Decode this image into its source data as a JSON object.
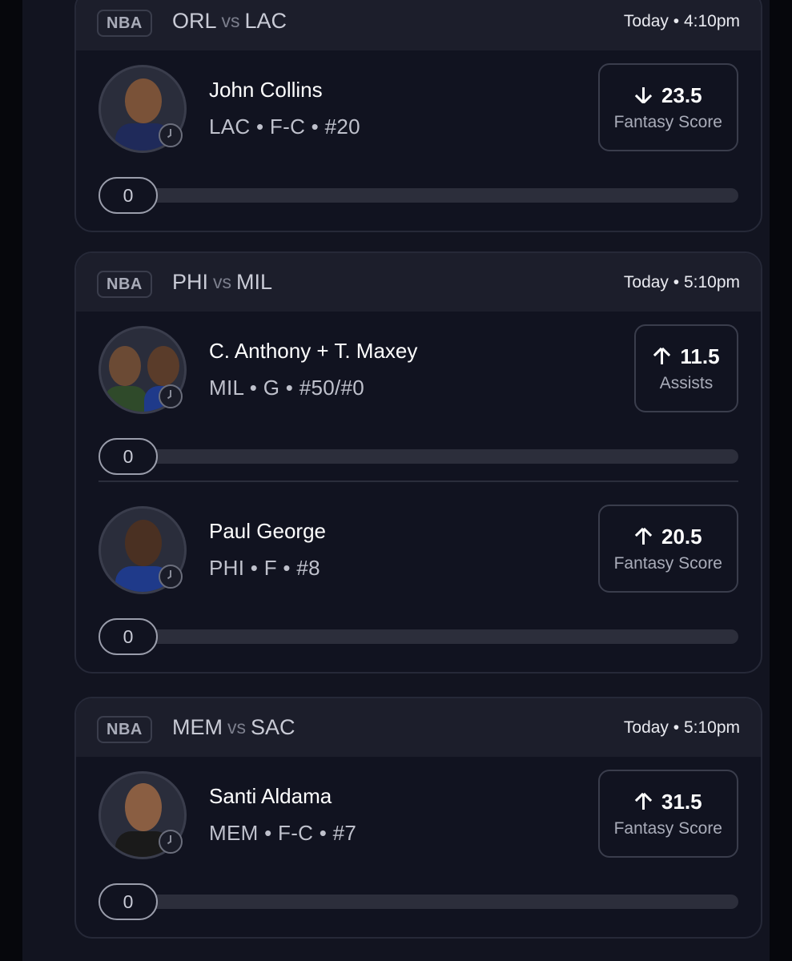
{
  "colors": {
    "background": "#06070c",
    "card": "#111320",
    "header": "#1c1e2b",
    "border": "#262938"
  },
  "cards": [
    {
      "league": "NBA",
      "team_a": "ORL",
      "vs": "vs",
      "team_b": "LAC",
      "time": "Today • 4:10pm",
      "players": [
        {
          "name": "John Collins",
          "meta": "LAC • F-C • #20",
          "direction": "down",
          "line": "23.5",
          "stat": "Fantasy Score",
          "progress": "0"
        }
      ]
    },
    {
      "league": "NBA",
      "team_a": "PHI",
      "vs": "vs",
      "team_b": "MIL",
      "time": "Today • 5:10pm",
      "players": [
        {
          "name": "C. Anthony + T. Maxey",
          "meta": "MIL • G • #50/#0",
          "direction": "up",
          "line": "11.5",
          "stat": "Assists",
          "progress": "0"
        },
        {
          "name": "Paul George",
          "meta": "PHI • F • #8",
          "direction": "up",
          "line": "20.5",
          "stat": "Fantasy Score",
          "progress": "0"
        }
      ]
    },
    {
      "league": "NBA",
      "team_a": "MEM",
      "vs": "vs",
      "team_b": "SAC",
      "time": "Today • 5:10pm",
      "players": [
        {
          "name": "Santi Aldama",
          "meta": "MEM • F-C • #7",
          "direction": "up",
          "line": "31.5",
          "stat": "Fantasy Score",
          "progress": "0"
        }
      ]
    }
  ],
  "icons": {
    "status": "clock-icon",
    "over": "arrow-up-icon",
    "under": "arrow-down-icon"
  }
}
